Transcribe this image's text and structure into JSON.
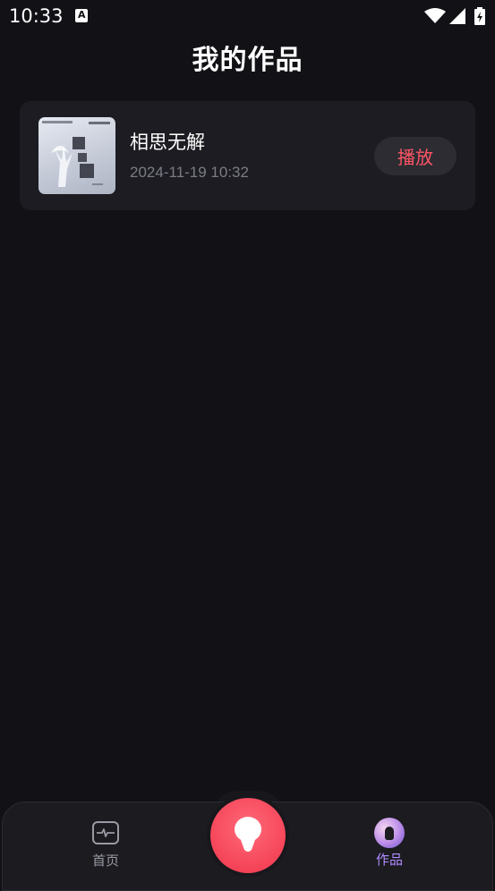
{
  "status_bar": {
    "time": "10:33"
  },
  "header": {
    "title": "我的作品"
  },
  "works": [
    {
      "title": "相思无解",
      "date": "2024-11-19 10:32",
      "play_label": "播放"
    }
  ],
  "bottom_nav": {
    "home_label": "首页",
    "works_label": "作品"
  },
  "colors": {
    "background": "#111116",
    "card": "#1c1c22",
    "accent_red": "#f54458",
    "active_purple": "#b28cff"
  },
  "icons": [
    "notification-a-icon",
    "wifi-icon",
    "signal-icon",
    "battery-icon",
    "home-pulse-icon",
    "microphone-icon",
    "works-icon"
  ]
}
